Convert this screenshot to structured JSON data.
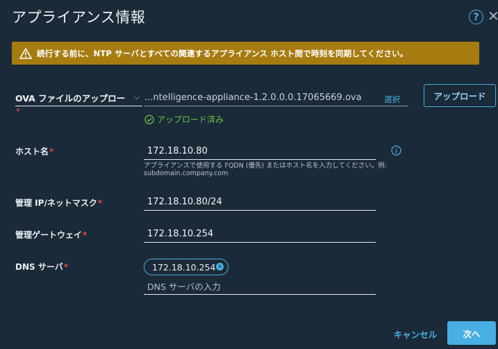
{
  "dialog": {
    "title": "アプライアンス情報",
    "help_icon": "help-circle-icon",
    "close_icon": "close-icon"
  },
  "warning": {
    "icon": "warning-triangle-icon",
    "text": "続行する前に、NTP サーバとすべての関連するアプライアンス ホスト間で時刻を同期してください。",
    "color": "#a67c10"
  },
  "ova": {
    "select_label": "OVA ファイルのアップロー",
    "required_mark": "*",
    "file_name": "...ntelligence-appliance-1.2.0.0.0.17065669.ova",
    "browse_label": "選択",
    "upload_button": "アップロード",
    "status_text": "アップロード済み",
    "status_icon": "check-circle-icon",
    "status_color": "#6cc04a"
  },
  "fields": {
    "hostname": {
      "label": "ホスト名",
      "required": "*",
      "value": "172.18.10.80",
      "helper": "アプライアンスで使用する FQDN (優先) またはホスト名を入力してください。例: subdomain.company.com",
      "info_icon": "info-icon"
    },
    "mgmt_ip": {
      "label": "管理 IP/ネットマスク",
      "required": "*",
      "value": "172.18.10.80/24"
    },
    "gateway": {
      "label": "管理ゲートウェイ",
      "required": "*",
      "value": "172.18.10.254"
    },
    "dns": {
      "label": "DNS サーバ",
      "required": "*",
      "chip": "172.18.10.254",
      "chip_remove_icon": "remove-chip-icon",
      "placeholder": "DNS サーバの入力"
    }
  },
  "footer": {
    "cancel": "キャンセル",
    "next": "次へ"
  },
  "colors": {
    "background": "#1b2a38",
    "accent": "#49aee2",
    "required": "#e6453f"
  }
}
